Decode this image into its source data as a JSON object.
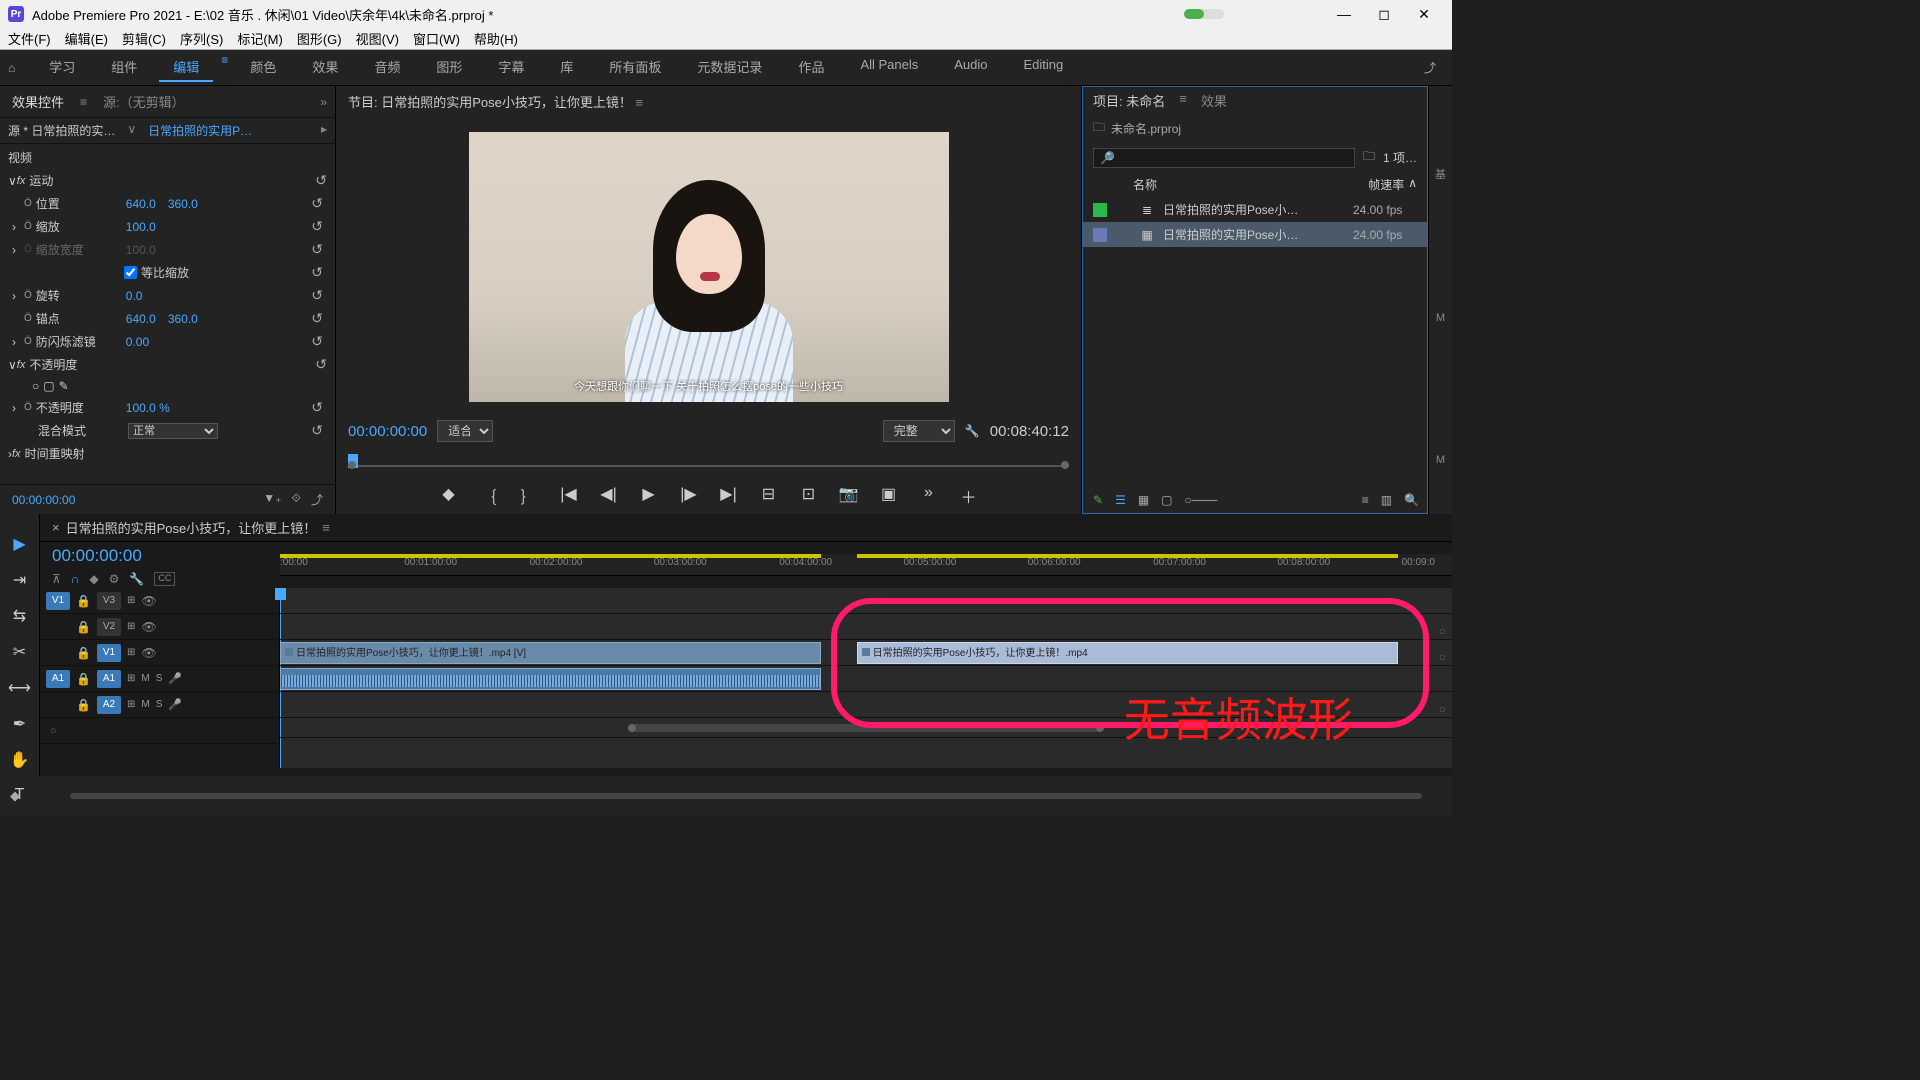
{
  "titlebar": {
    "app_badge": "Pr",
    "title": "Adobe Premiere Pro 2021 - E:\\02 音乐 . 休闲\\01 Video\\庆余年\\4k\\未命名.prproj *"
  },
  "menubar": [
    "文件(F)",
    "编辑(E)",
    "剪辑(C)",
    "序列(S)",
    "标记(M)",
    "图形(G)",
    "视图(V)",
    "窗口(W)",
    "帮助(H)"
  ],
  "workspaces": {
    "tabs": [
      "学习",
      "组件",
      "编辑",
      "颜色",
      "效果",
      "音频",
      "图形",
      "字幕",
      "库",
      "所有面板",
      "元数据记录",
      "作品",
      "All Panels",
      "Audio",
      "Editing"
    ],
    "active": "编辑"
  },
  "effect_controls": {
    "tabs": [
      "效果控件",
      "源:（无剪辑）"
    ],
    "source": "源 * 日常拍照的实…",
    "sequence": "日常拍照的实用P…",
    "section_video": "视频",
    "motion": {
      "label": "运动",
      "position": {
        "label": "位置",
        "x": "640.0",
        "y": "360.0"
      },
      "scale": {
        "label": "缩放",
        "v": "100.0"
      },
      "scale_w": {
        "label": "缩放宽度",
        "v": "100.0"
      },
      "uniform": {
        "label": "等比缩放"
      },
      "rotation": {
        "label": "旋转",
        "v": "0.0"
      },
      "anchor": {
        "label": "锚点",
        "x": "640.0",
        "y": "360.0"
      },
      "flicker": {
        "label": "防闪烁滤镜",
        "v": "0.00"
      }
    },
    "opacity": {
      "label": "不透明度",
      "value": {
        "label": "不透明度",
        "v": "100.0 %"
      },
      "blend": {
        "label": "混合模式",
        "v": "正常"
      }
    },
    "remap": {
      "label": "时间重映射"
    },
    "timecode": "00:00:00:00"
  },
  "program": {
    "title": "节目: 日常拍照的实用Pose小技巧，让你更上镜！",
    "subtitle": "今天想跟你们聊一下 关于拍照怎么摆pose的一些小技巧",
    "tc_left": "00:00:00:00",
    "fit": "适合",
    "res": "完整",
    "tc_right": "00:08:40:12"
  },
  "project": {
    "tabs": [
      "项目: 未命名",
      "效果"
    ],
    "bin": "未命名.prproj",
    "search_placeholder": "",
    "count": "1 项…",
    "headers": {
      "name": "名称",
      "fps": "帧速率"
    },
    "items": [
      {
        "swatch": "#2ab84a",
        "icon": "≣",
        "name": "日常拍照的实用Pose小…",
        "fps": "24.00 fps",
        "selected": false
      },
      {
        "swatch": "#6a7ab8",
        "icon": "▦",
        "name": "日常拍照的实用Pose小…",
        "fps": "24.00 fps",
        "selected": true
      }
    ]
  },
  "right_strip": [
    "基",
    "M",
    "M"
  ],
  "timeline": {
    "title": "日常拍照的实用Pose小技巧，让你更上镜！",
    "tc": "00:00:00:00",
    "ruler": [
      ":00:00",
      "00:01:00:00",
      "00:02:00:00",
      "00:03:00:00",
      "00:04:00:00",
      "00:05:00:00",
      "00:06:00:00",
      "00:07:00:00",
      "00:08:00:00",
      "00:09:0"
    ],
    "tracks": {
      "v3": "V3",
      "v2": "V2",
      "v1": "V1",
      "a1": "A1",
      "a2": "A2",
      "src_v1": "V1",
      "src_a1": "A1"
    },
    "clip1": "日常拍照的实用Pose小技巧，让你更上镜！.mp4 [V]",
    "clip2": "日常拍照的实用Pose小技巧，让你更上镜！.mp4",
    "m": "M",
    "s": "S"
  },
  "annotation": "无音频波形",
  "footer": {
    "cc": "◆"
  }
}
